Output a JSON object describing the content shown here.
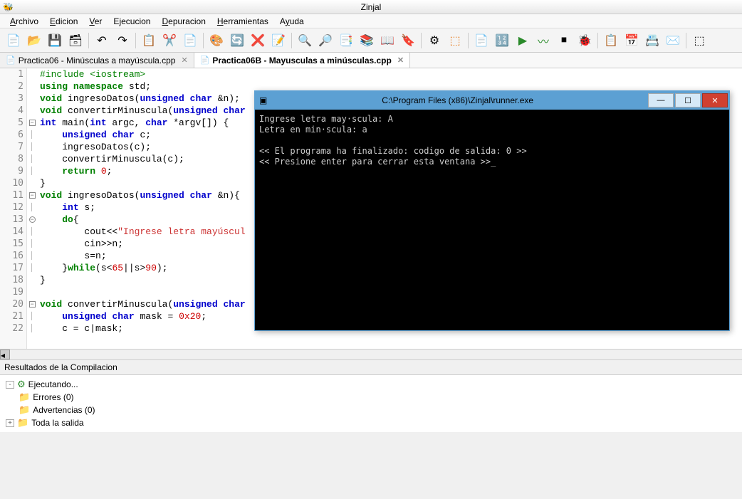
{
  "app": {
    "title": "Zinjal"
  },
  "menu": {
    "items": [
      "Archivo",
      "Edicion",
      "Ver",
      "Ejecucion",
      "Depuracion",
      "Herramientas",
      "Ayuda"
    ]
  },
  "tabs": [
    {
      "label": "Practica06 - Minúsculas a mayúscula.cpp",
      "active": false
    },
    {
      "label": "Practica06B - Mayusculas a minúsculas.cpp",
      "active": true
    }
  ],
  "code": {
    "lines": [
      {
        "n": 1,
        "fold": "",
        "html": "<span class='pre'>#include &lt;iostream&gt;</span>"
      },
      {
        "n": 2,
        "fold": "",
        "html": "<span class='kw-green'>using</span> <span class='kw-green'>namespace</span> std;"
      },
      {
        "n": 3,
        "fold": "",
        "html": "<span class='kw-green'>void</span> ingresoDatos(<span class='kw-blue'>unsigned</span> <span class='kw-blue'>char</span> &amp;n);"
      },
      {
        "n": 4,
        "fold": "",
        "html": "<span class='kw-green'>void</span> convertirMinuscula(<span class='kw-blue'>unsigned</span> <span class='kw-blue'>char</span>"
      },
      {
        "n": 5,
        "fold": "-",
        "html": "<span class='kw-blue'>int</span> main(<span class='kw-blue'>int</span> argc, <span class='kw-blue'>char</span> *argv[]) {"
      },
      {
        "n": 6,
        "fold": "|",
        "html": "    <span class='kw-blue'>unsigned</span> <span class='kw-blue'>char</span> c;"
      },
      {
        "n": 7,
        "fold": "|",
        "html": "    ingresoDatos(c);"
      },
      {
        "n": 8,
        "fold": "|",
        "html": "    convertirMinuscula(c);"
      },
      {
        "n": 9,
        "fold": "|",
        "html": "    <span class='kw-green'>return</span> <span class='kw-red'>0</span>;"
      },
      {
        "n": 10,
        "fold": "",
        "html": "}"
      },
      {
        "n": 11,
        "fold": "-",
        "html": "<span class='kw-green'>void</span> ingresoDatos(<span class='kw-blue'>unsigned</span> <span class='kw-blue'>char</span> &amp;n){"
      },
      {
        "n": 12,
        "fold": "|",
        "html": "    <span class='kw-blue'>int</span> s;"
      },
      {
        "n": 13,
        "fold": "o",
        "html": "    <span class='kw-green'>do</span>{"
      },
      {
        "n": 14,
        "fold": "|",
        "html": "        cout&lt;&lt;<span class='str'>\"Ingrese letra mayúscul</span>"
      },
      {
        "n": 15,
        "fold": "|",
        "html": "        cin&gt;&gt;n;"
      },
      {
        "n": 16,
        "fold": "|",
        "html": "        s=n;"
      },
      {
        "n": 17,
        "fold": "|",
        "html": "    }<span class='kw-green'>while</span>(s&lt;<span class='kw-red'>65</span>||s&gt;<span class='kw-red'>90</span>);"
      },
      {
        "n": 18,
        "fold": "",
        "html": "}"
      },
      {
        "n": 19,
        "fold": "",
        "html": ""
      },
      {
        "n": 20,
        "fold": "-",
        "html": "<span class='kw-green'>void</span> convertirMinuscula(<span class='kw-blue'>unsigned</span> <span class='kw-blue'>char</span>"
      },
      {
        "n": 21,
        "fold": "|",
        "html": "    <span class='kw-blue'>unsigned</span> <span class='kw-blue'>char</span> mask = <span class='hex'>0x20</span>;"
      },
      {
        "n": 22,
        "fold": "|",
        "html": "    c = c|mask;"
      }
    ]
  },
  "console": {
    "title": "C:\\Program Files (x86)\\Zinjal\\runner.exe",
    "lines": [
      "Ingrese letra may·scula: A",
      "Letra en min·scula: a",
      "",
      "<< El programa ha finalizado: codigo de salida: 0 >>",
      "<< Presione enter para cerrar esta ventana >>_"
    ]
  },
  "compile": {
    "header": "Resultados de la Compilacion",
    "rows": [
      {
        "icon": "⚙",
        "color": "#2a8a2a",
        "label": "Ejecutando...",
        "exp": "-"
      },
      {
        "icon": "📁",
        "color": "#c08030",
        "label": "Errores (0)",
        "exp": ""
      },
      {
        "icon": "📁",
        "color": "#c08030",
        "label": "Advertencias (0)",
        "exp": ""
      },
      {
        "icon": "📁",
        "color": "#c08030",
        "label": "Toda la salida",
        "exp": "+"
      }
    ]
  }
}
